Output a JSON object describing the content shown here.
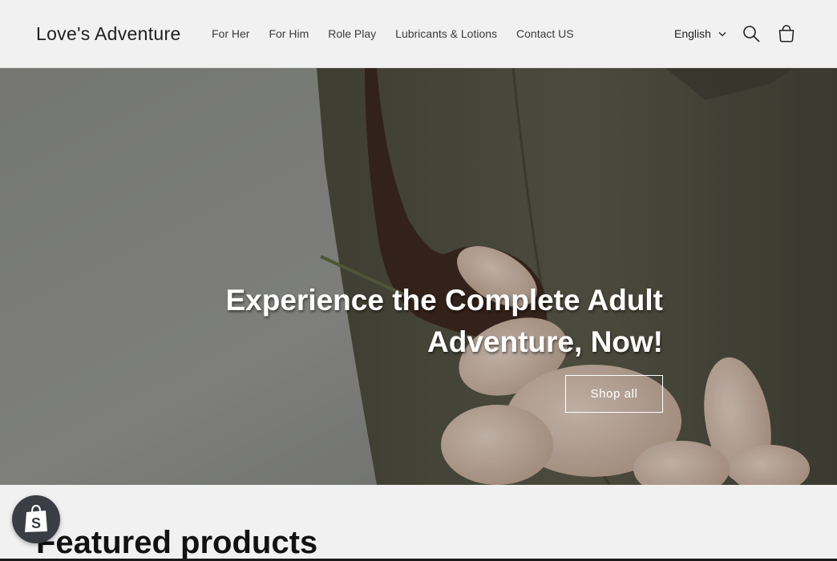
{
  "header": {
    "logo": "Love's Adventure",
    "nav": [
      {
        "label": "For Her"
      },
      {
        "label": "For Him"
      },
      {
        "label": "Role Play"
      },
      {
        "label": "Lubricants & Lotions"
      },
      {
        "label": "Contact US"
      }
    ],
    "language": "English",
    "icons": [
      "search-icon",
      "cart-icon",
      "chevron-down-icon"
    ]
  },
  "hero": {
    "heading": "Experience the Complete Adult Adventure, Now!",
    "button_label": "Shop all"
  },
  "featured": {
    "title": "Featured products"
  },
  "badge": {
    "icon": "shopify-bag-icon"
  },
  "colors": {
    "background": "#f1f1f1",
    "text": "#121212",
    "hero_overlay_text": "#ffffff",
    "badge": "#3a3d44"
  }
}
